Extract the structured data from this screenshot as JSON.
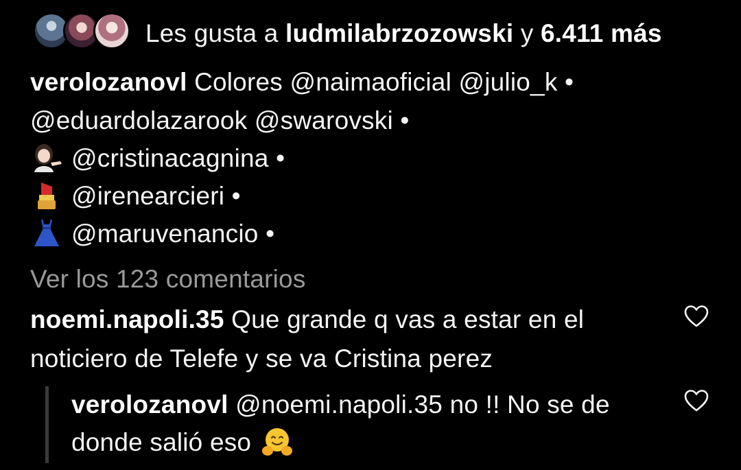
{
  "likes": {
    "prefix": "Les gusta a",
    "user": "ludmilabrzozowski",
    "joiner": "y",
    "count_text": "6.411 más",
    "avatars": [
      "avatar-1",
      "avatar-2",
      "avatar-3"
    ]
  },
  "caption": {
    "author": "verolozanovl",
    "line1_text": "Colores",
    "line1_mention_a": "@naimaoficial",
    "line1_mention_b": "@julio_k",
    "line2_mention_a": "@eduardolazarook",
    "line2_mention_b": "@swarovski",
    "line3_mention": "@cristinacagnina",
    "line4_mention": "@irenearcieri",
    "line5_mention": "@maruvenancio",
    "bullet": "•",
    "emojis": [
      "woman-tipping-hand-icon",
      "lipstick-icon",
      "dress-icon"
    ]
  },
  "view_comments": "Ver los 123 comentarios",
  "comments": [
    {
      "user": "noemi.napoli.35",
      "text_line1": "Que grande q vas a estar en el",
      "text_line2": "noticiero de Telefe y se va Cristina perez"
    }
  ],
  "reply": {
    "user": "verolozanovl",
    "mention": "@noemi.napoli.35",
    "text_line1": "no !! No se de",
    "text_line2": "donde salió eso",
    "emoji": "hugging-face-icon"
  },
  "colors": {
    "background": "#000000",
    "text": "#f5f5f5",
    "muted": "#9a9a9a",
    "reply_bar": "#3a3a3a"
  }
}
